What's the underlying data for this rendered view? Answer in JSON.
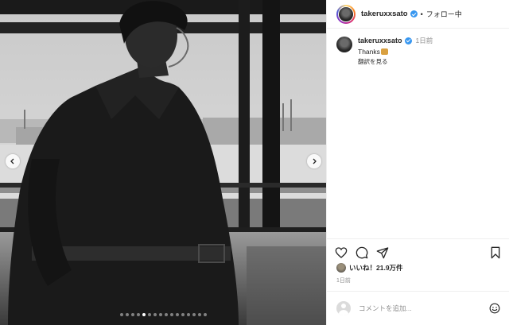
{
  "post": {
    "username": "takeruxxsato",
    "follow_status": "フォロー中",
    "separator": "•",
    "caption_user": "takeruxxsato",
    "caption_time": "1日前",
    "caption_text": "Thanks",
    "translate_label": "翻訳を見る",
    "likes_text": "いいね！21.9万件",
    "posted_ago": "1日前",
    "comment_placeholder": "コメントを追加...",
    "verified": true
  },
  "carousel": {
    "slide_count": 16,
    "active_index": 4
  },
  "icons": {
    "like": "heart-icon",
    "comment": "comment-icon",
    "share": "share-icon",
    "save": "bookmark-icon",
    "prev": "chevron-left-icon",
    "next": "chevron-right-icon",
    "emoji": "emoji-icon"
  },
  "colors": {
    "verified_blue": "#3897f0",
    "secondary_text": "#8e8e8e",
    "primary_text": "#262626"
  }
}
